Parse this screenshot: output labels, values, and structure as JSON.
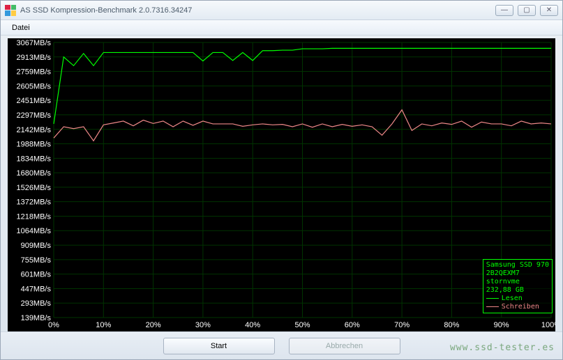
{
  "window": {
    "title": "AS SSD Kompression-Benchmark 2.0.7316.34247"
  },
  "menu": {
    "file": "Datei"
  },
  "buttons": {
    "start": "Start",
    "cancel": "Abbrechen"
  },
  "legend": {
    "line1": "Samsung SSD 970",
    "line2": "2B2QEXM7",
    "line3": "stornvme",
    "line4": "232,88 GB",
    "read": "Lesen",
    "write": "Schreiben"
  },
  "watermark": "www.ssd-tester.es",
  "chart_data": {
    "type": "line",
    "xlabel": "",
    "ylabel": "",
    "x_ticks": [
      "0%",
      "10%",
      "20%",
      "30%",
      "40%",
      "50%",
      "60%",
      "70%",
      "80%",
      "90%",
      "100%"
    ],
    "y_ticks": [
      "139MB/s",
      "293MB/s",
      "447MB/s",
      "601MB/s",
      "755MB/s",
      "909MB/s",
      "1064MB/s",
      "1218MB/s",
      "1372MB/s",
      "1526MB/s",
      "1680MB/s",
      "1834MB/s",
      "1988MB/s",
      "2142MB/s",
      "2297MB/s",
      "2451MB/s",
      "2605MB/s",
      "2759MB/s",
      "2913MB/s",
      "3067MB/s"
    ],
    "xlim": [
      0,
      100
    ],
    "ylim": [
      139,
      3067
    ],
    "x": [
      0,
      2,
      4,
      6,
      8,
      10,
      12,
      14,
      16,
      18,
      20,
      22,
      24,
      26,
      28,
      30,
      32,
      34,
      36,
      38,
      40,
      42,
      44,
      46,
      48,
      50,
      52,
      54,
      56,
      58,
      60,
      62,
      64,
      66,
      68,
      70,
      72,
      74,
      76,
      78,
      80,
      82,
      84,
      86,
      88,
      90,
      92,
      94,
      96,
      98,
      100
    ],
    "series": [
      {
        "name": "Lesen",
        "color": "#00ff00",
        "values": [
          2200,
          2913,
          2820,
          2950,
          2820,
          2960,
          2960,
          2960,
          2960,
          2960,
          2960,
          2960,
          2960,
          2960,
          2960,
          2870,
          2960,
          2960,
          2875,
          2960,
          2875,
          2980,
          2980,
          2985,
          2985,
          3000,
          3000,
          3000,
          3005,
          3005,
          3005,
          3005,
          3005,
          3005,
          3005,
          3005,
          3005,
          3005,
          3005,
          3005,
          3005,
          3005,
          3005,
          3005,
          3005,
          3005,
          3005,
          3005,
          3005,
          3005,
          3005
        ]
      },
      {
        "name": "Schreiben",
        "color": "#ee8888",
        "values": [
          2050,
          2170,
          2150,
          2170,
          2020,
          2190,
          2210,
          2230,
          2180,
          2240,
          2205,
          2230,
          2170,
          2230,
          2185,
          2230,
          2200,
          2200,
          2200,
          2175,
          2190,
          2200,
          2190,
          2195,
          2170,
          2200,
          2165,
          2200,
          2170,
          2195,
          2175,
          2190,
          2170,
          2080,
          2200,
          2350,
          2130,
          2200,
          2180,
          2210,
          2195,
          2230,
          2165,
          2220,
          2200,
          2200,
          2180,
          2230,
          2200,
          2210,
          2200
        ]
      }
    ]
  }
}
